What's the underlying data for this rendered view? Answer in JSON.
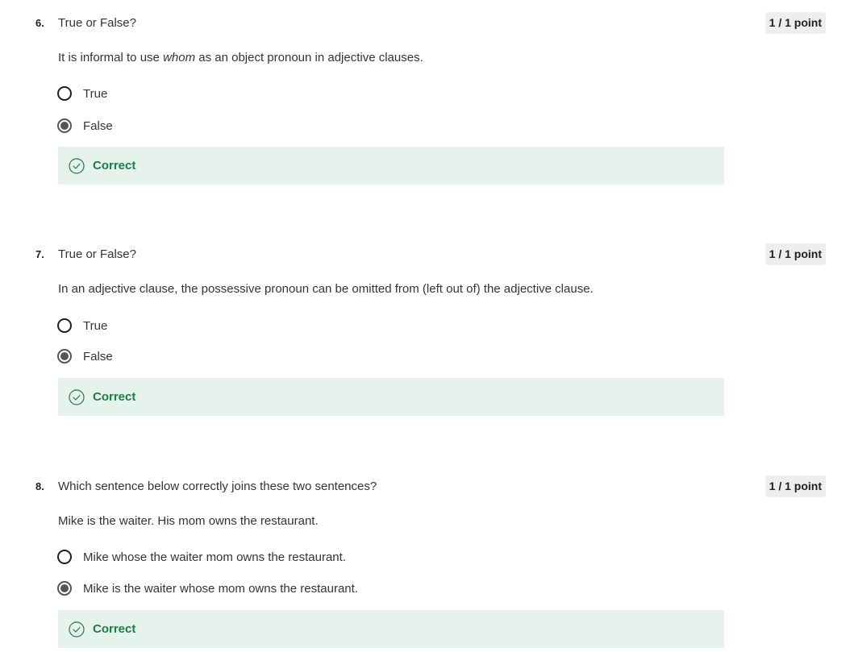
{
  "questions": [
    {
      "number": "6.",
      "title": "True or False?",
      "points": "1 / 1 point",
      "prompt_before": "It is informal to use ",
      "prompt_em": "whom",
      "prompt_after": " as an object pronoun in adjective clauses.",
      "options": [
        {
          "label": "True",
          "selected": false
        },
        {
          "label": "False",
          "selected": true
        }
      ],
      "feedback": "Correct"
    },
    {
      "number": "7.",
      "title": "True or False?",
      "points": "1 / 1 point",
      "prompt": "In an adjective clause, the possessive pronoun can be omitted from (left out of) the adjective clause.",
      "options": [
        {
          "label": "True",
          "selected": false
        },
        {
          "label": "False",
          "selected": true
        }
      ],
      "feedback": "Correct"
    },
    {
      "number": "8.",
      "title": "Which sentence below correctly joins these two sentences?",
      "points": "1 / 1 point",
      "prompt": "Mike is the waiter. His mom owns the restaurant.",
      "options": [
        {
          "label": "Mike whose the waiter mom owns the restaurant.",
          "selected": false
        },
        {
          "label": "Mike is the waiter whose mom owns the restaurant.",
          "selected": true
        }
      ],
      "feedback": "Correct"
    }
  ],
  "colors": {
    "feedback_bg": "#e6f2ec",
    "feedback_text": "#1e7a4b",
    "points_bg": "#eeeeee"
  },
  "icons": {
    "feedback": "check-circle-icon",
    "selected_option": "radio-checked-icon",
    "unselected_option": "radio-unchecked-icon"
  }
}
